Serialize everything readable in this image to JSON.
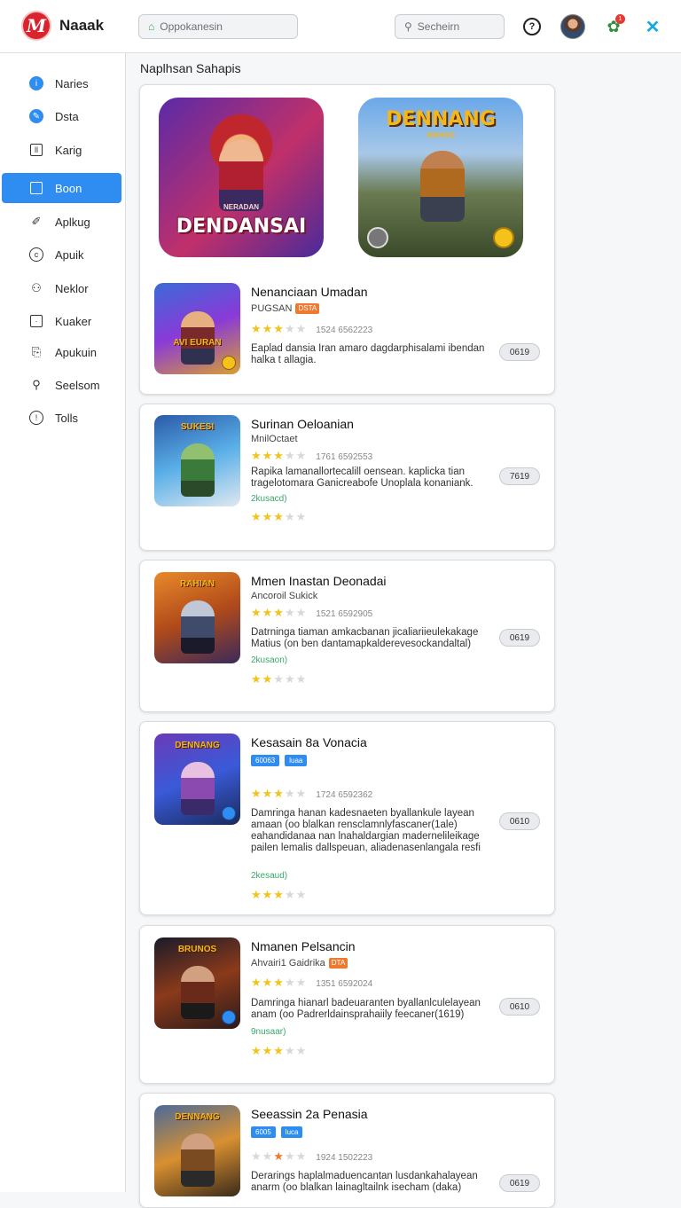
{
  "header": {
    "app_name": "Naaak",
    "field1_placeholder": "Oppokanesin",
    "search_placeholder": "Secheirn",
    "notification_count": "1"
  },
  "sidebar": {
    "items": [
      {
        "label": "Naries",
        "icon": "info-icon"
      },
      {
        "label": "Dsta",
        "icon": "edit-icon"
      },
      {
        "label": "Karig",
        "icon": "pause-icon"
      },
      {
        "label": "Boon",
        "icon": "bag-icon",
        "active": true
      },
      {
        "label": "Aplkug",
        "icon": "pen-icon"
      },
      {
        "label": "Apuik",
        "icon": "copyright-icon"
      },
      {
        "label": "Neklor",
        "icon": "network-icon"
      },
      {
        "label": "Kuaker",
        "icon": "square-dot-icon"
      },
      {
        "label": "Apukuin",
        "icon": "export-icon"
      },
      {
        "label": "Seelsom",
        "icon": "user-icon"
      },
      {
        "label": "Tolls",
        "icon": "alert-icon"
      }
    ]
  },
  "main": {
    "section_title": "Naplhsan Sahapis",
    "featured": [
      {
        "title": "DENDANSAI",
        "subtitle": "NERADAN"
      },
      {
        "title": "DENNANG",
        "subtitle": "AIMANG"
      }
    ],
    "items": [
      {
        "title": "Nenanciaan Umadan",
        "subtitle": "PUGSAN",
        "tags": [
          "DSTA"
        ],
        "thumb_title": "AVI EURAN",
        "stars_on": 3,
        "stars_half": 0,
        "meta": "1524 6562223",
        "desc": "Eaplad dansia Iran amaro dagdarphisalami ibendan halka t allagia.",
        "note": "",
        "stars2": null,
        "pill": "0619"
      },
      {
        "title": "Surinan Oeloanian",
        "subtitle": "MnilOctaet",
        "tags": [],
        "thumb_title": "SUKESI",
        "stars_on": 3,
        "stars_half": 0,
        "meta": "1761 6592553",
        "desc": "Rapika lamanallortecalill oensean. kaplicka tian tragelotomara Ganicreabofe Unoplala konaniank.",
        "note": "2kusacd)",
        "stars2": 3,
        "pill": "7619"
      },
      {
        "title": "Mmen Inastan Deonadai",
        "subtitle": "Ancoroil Sukick",
        "tags": [],
        "thumb_title": "RAHIAN",
        "stars_on": 3,
        "stars_half": 0,
        "meta": "1521 6592905",
        "desc": "Datrninga tiaman amkacbanan jicaliariieulekakage Matius (on ben dantamapkalderevesockandaltal)",
        "note": "2kusaon)",
        "stars2": 2,
        "pill": "0619"
      },
      {
        "title": "Kesasain 8a Vonacia",
        "subtitle": "",
        "tags": [
          "60063",
          "luaa"
        ],
        "thumb_title": "DENNANG",
        "stars_on": 3,
        "stars_half": 0,
        "meta": "1724 6592362",
        "desc": "Damringa hanan kadesnaeten byallankule layean amaan (oo blalkan rensclamnlyfascaner(1ale) eahandidanaa nan lnahaldargian madernelileikage pailen lemalis dallspeuan, aliadenasenlangala resfi",
        "note": "2kesaud)",
        "stars2": 3,
        "pill": "0610"
      },
      {
        "title": "Nmanen Pelsancin",
        "subtitle": "Ahvairi1 Gaidrika",
        "tags": [
          "DTA"
        ],
        "thumb_title": "BRUNOS",
        "stars_on": 3,
        "stars_half": 0,
        "meta": "1351 6592024",
        "desc": "Damringa hianarl badeuaranten byallanlculelayean anam (oo Padrerldainsprahaiily feecaner(1619)",
        "note": "9nusaar)",
        "stars2": 3,
        "pill": "0610"
      },
      {
        "title": "Seeassin 2a Penasia",
        "subtitle": "",
        "tags": [
          "6005",
          "luca"
        ],
        "thumb_title": "DENNANG",
        "stars_on": 2,
        "stars_half": 1,
        "meta": "1924 1502223",
        "desc": "Derarings haplalmaduencantan lusdankahalayean anarm (oo blalkan lainagltailnk isecham (daka)",
        "note": "",
        "stars2": null,
        "pill": "0619"
      }
    ]
  }
}
